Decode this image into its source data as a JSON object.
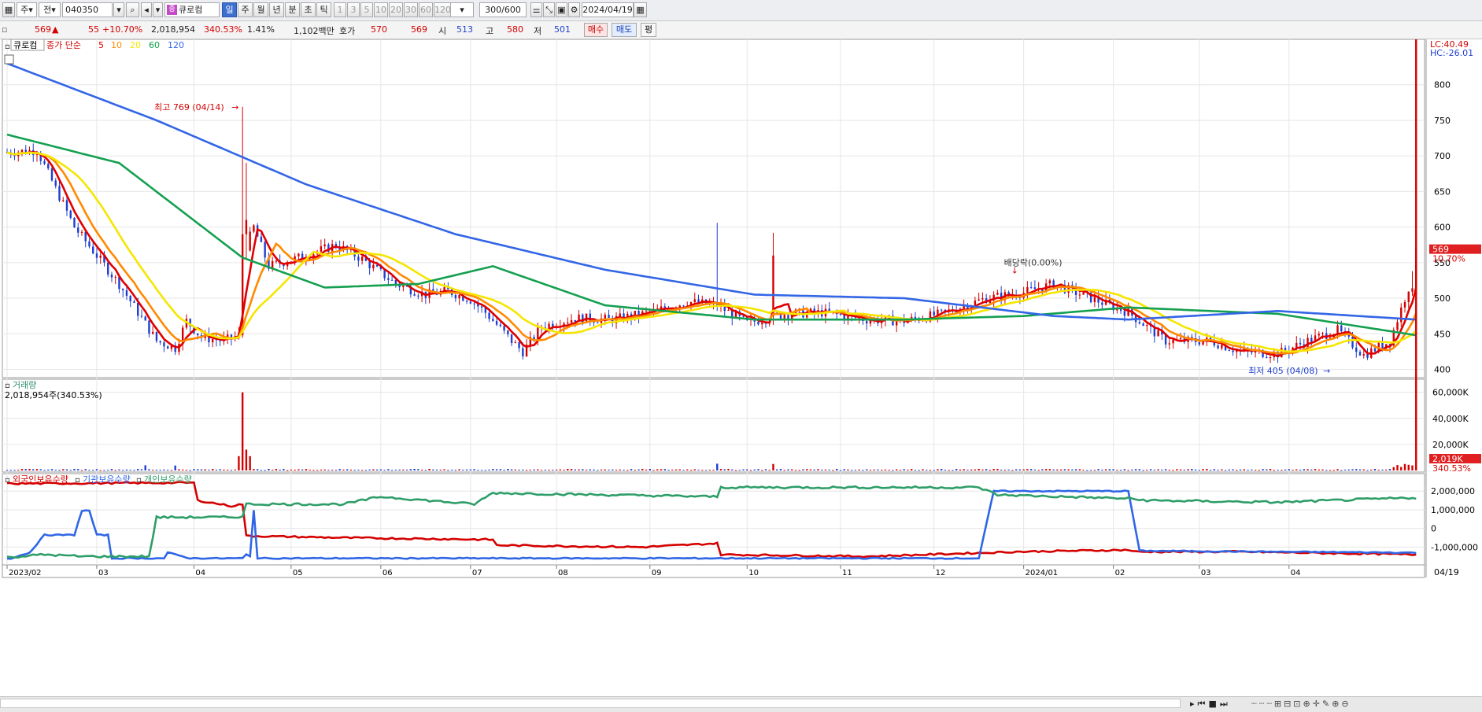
{
  "toolbar": {
    "type_label": "주",
    "tab_label": "전",
    "code": "040350",
    "name_badge": "종",
    "name": "큐로컴",
    "periods": [
      "일",
      "주",
      "월",
      "년",
      "분",
      "초",
      "틱"
    ],
    "intervals": [
      "1",
      "3",
      "5",
      "10",
      "20",
      "30",
      "60",
      "120"
    ],
    "count": "300/600",
    "date": "2024/04/19"
  },
  "quote": {
    "price": "569",
    "change": "55",
    "change_pct": "+10.70%",
    "volume": "2,018,954",
    "volume_ratio": "340.53%",
    "turnover": "1.41%",
    "amount": "1,102백만",
    "bid_label": "호가",
    "bid1": "570",
    "bid2": "569",
    "open_label": "시",
    "open": "513",
    "high_label": "고",
    "high": "580",
    "low_label": "저",
    "low": "501",
    "buy_button": "매수",
    "sell_button": "매도",
    "eval_button": "평"
  },
  "panels": {
    "price_legend": {
      "name": "큐로컴",
      "prefix": "종가 단순",
      "periods": [
        "5",
        "10",
        "20",
        "60",
        "120"
      ]
    },
    "volume_title": "거래량",
    "volume_info": "2,018,954주(340.53%)",
    "holdings_legend": [
      "외국인보유수량",
      "기관보유수량",
      "개인보유수량"
    ],
    "lc_label": "LC:40.49",
    "hc_label": "HC:-26.01",
    "price_tag": "569",
    "pct_tag": "10.70%",
    "vol_tag": "2,019K",
    "vol_pct_tag": "340.53%",
    "last_date": "04/19"
  },
  "colors": {
    "up": "#d40000",
    "down": "#1f3fd0",
    "ma5": "#e00000",
    "ma10": "#ff8a00",
    "ma20": "#f5e600",
    "ma60": "#14a050",
    "ma120": "#3366e6",
    "foreign": "#d40000",
    "institution": "#2f66e6",
    "individual": "#2e9e68"
  },
  "chart_data": [
    {
      "type": "candlestick",
      "title": "큐로컴",
      "x": [
        "2023/02",
        "03",
        "04",
        "05",
        "06",
        "07",
        "08",
        "09",
        "10",
        "11",
        "12",
        "2024/01",
        "02",
        "03",
        "04"
      ],
      "y_ticks": [
        400,
        450,
        500,
        550,
        600,
        650,
        700,
        750,
        800
      ],
      "ylim": [
        395,
        855
      ],
      "ma_periods": [
        5,
        10,
        20,
        60,
        120
      ],
      "annotations": [
        {
          "text": "최고 769 (04/14)",
          "value": 769
        },
        {
          "text": "최저 405 (04/08)",
          "value": 405
        },
        {
          "text": "배당락(0.00%)"
        }
      ],
      "last": {
        "open": 513,
        "high": 580,
        "low": 501,
        "close": 569
      }
    },
    {
      "type": "bar",
      "title": "거래량",
      "y_ticks": [
        "20,000K",
        "40,000K",
        "60,000K"
      ],
      "ylim": [
        0,
        64000
      ],
      "last_value_k": 2019
    },
    {
      "type": "line",
      "title": "보유수량",
      "series": [
        {
          "name": "외국인보유수량"
        },
        {
          "name": "기관보유수량"
        },
        {
          "name": "개인보유수량"
        }
      ],
      "y_ticks": [
        "-1,000,000",
        "0",
        "1,000,000",
        "2,000,000"
      ]
    }
  ]
}
